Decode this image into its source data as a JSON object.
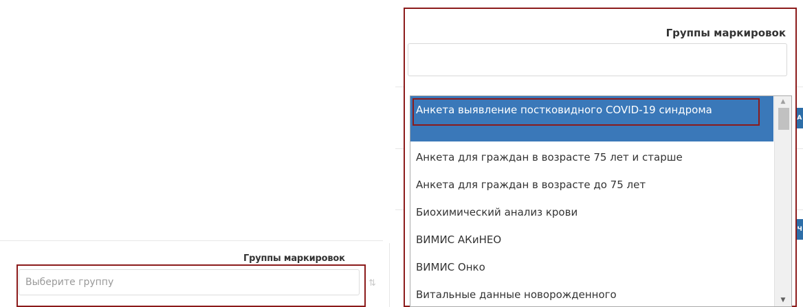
{
  "lower_filter": {
    "label": "Группы маркировок",
    "placeholder": "Выберите группу",
    "sort_icon": "sort-icon",
    "sort_glyph": "⇅"
  },
  "dropdown": {
    "label": "Группы маркировок",
    "search_value": "",
    "options": [
      "Анкета выявление постковидного COVID-19 синдрома",
      "Анкета для граждан в возрасте 75 лет и старше",
      "Анкета для граждан в возрасте до 75 лет",
      "Биохимический анализ крови",
      "ВИМИС АКиНЕО",
      "ВИМИС Онко",
      "Витальные данные новорожденного"
    ],
    "selected_index": 0,
    "scroll_up_glyph": "▲",
    "scroll_down_glyph": "▼"
  },
  "background": {
    "btn_stub_1": "КА",
    "btn_stub_2": "ОЧ"
  },
  "colors": {
    "highlight_border": "#8b1a1a",
    "selected_bg": "#3a78b9",
    "button_blue": "#2d6ea8"
  }
}
